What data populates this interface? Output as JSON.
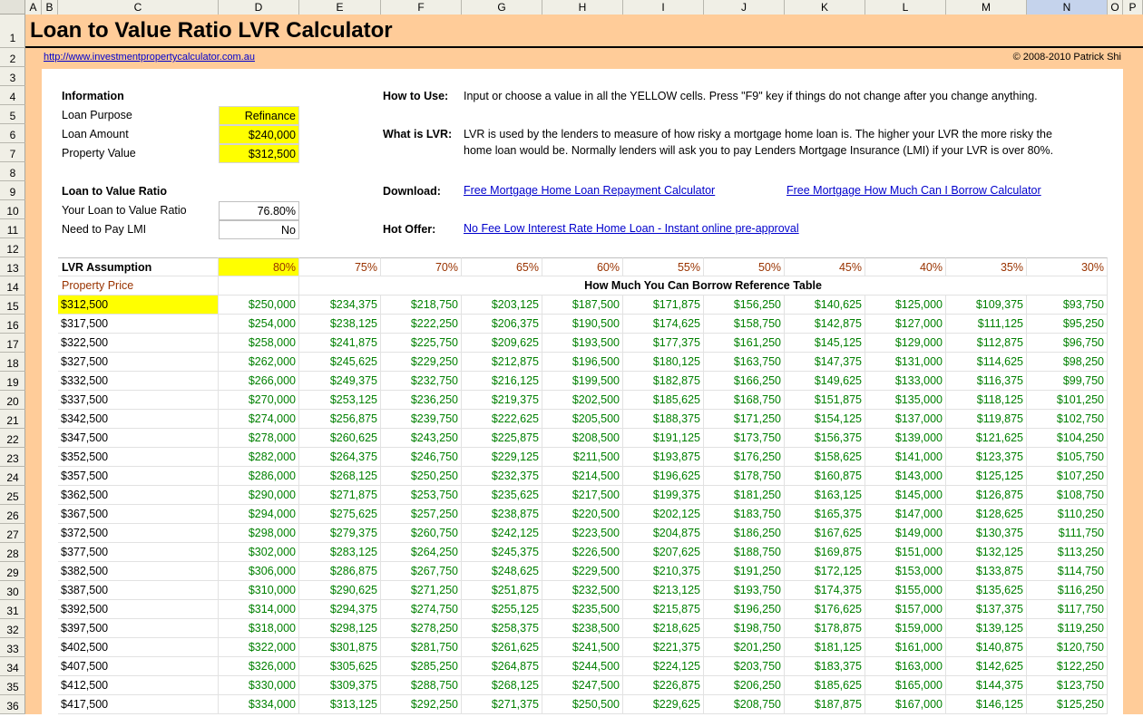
{
  "columns": [
    "A",
    "B",
    "C",
    "D",
    "E",
    "F",
    "G",
    "H",
    "I",
    "J",
    "K",
    "L",
    "M",
    "N",
    "O",
    "P"
  ],
  "selected_column": "N",
  "title": "Loan to Value Ratio LVR Calculator",
  "site_link": "http://www.investmentpropertycalculator.com.au",
  "copyright": "© 2008-2010 Patrick Shi",
  "information": {
    "heading": "Information",
    "loan_purpose_label": "Loan Purpose",
    "loan_purpose_value": "Refinance",
    "loan_amount_label": "Loan Amount",
    "loan_amount_value": "$240,000",
    "property_value_label": "Property Value",
    "property_value_value": "$312,500"
  },
  "ratio": {
    "heading": "Loan to Value Ratio",
    "your_lvr_label": "Your Loan to Value Ratio",
    "your_lvr_value": "76.80%",
    "lmi_label": "Need to Pay LMI",
    "lmi_value": "No"
  },
  "how_to_use": {
    "label": "How to Use:",
    "text": "Input or choose a value in all the YELLOW cells. Press \"F9\" key if things do not change after you change anything."
  },
  "what_is_lvr": {
    "label": "What is LVR:",
    "line1": "LVR is used by the lenders to measure of how risky a mortgage home loan is. The higher your LVR the more risky the",
    "line2": "home loan would be. Normally lenders will ask you to pay Lenders Mortgage Insurance (LMI) if your LVR is over 80%."
  },
  "download": {
    "label": "Download:",
    "link1": "Free Mortgage Home Loan Repayment Calculator",
    "link2": "Free Mortgage How Much Can I Borrow Calculator"
  },
  "hot_offer": {
    "label": "Hot Offer:",
    "link": "No Fee Low Interest Rate Home Loan - Instant online pre-approval"
  },
  "table": {
    "assumption_label": "LVR Assumption",
    "property_price_label": "Property Price",
    "reference_title": "How Much You Can Borrow Reference Table",
    "percents": [
      "80%",
      "75%",
      "70%",
      "65%",
      "60%",
      "55%",
      "50%",
      "45%",
      "40%",
      "35%",
      "30%"
    ],
    "rows": [
      {
        "price": "$312,500",
        "values": [
          "$250,000",
          "$234,375",
          "$218,750",
          "$203,125",
          "$187,500",
          "$171,875",
          "$156,250",
          "$140,625",
          "$125,000",
          "$109,375",
          "$93,750"
        ]
      },
      {
        "price": "$317,500",
        "values": [
          "$254,000",
          "$238,125",
          "$222,250",
          "$206,375",
          "$190,500",
          "$174,625",
          "$158,750",
          "$142,875",
          "$127,000",
          "$111,125",
          "$95,250"
        ]
      },
      {
        "price": "$322,500",
        "values": [
          "$258,000",
          "$241,875",
          "$225,750",
          "$209,625",
          "$193,500",
          "$177,375",
          "$161,250",
          "$145,125",
          "$129,000",
          "$112,875",
          "$96,750"
        ]
      },
      {
        "price": "$327,500",
        "values": [
          "$262,000",
          "$245,625",
          "$229,250",
          "$212,875",
          "$196,500",
          "$180,125",
          "$163,750",
          "$147,375",
          "$131,000",
          "$114,625",
          "$98,250"
        ]
      },
      {
        "price": "$332,500",
        "values": [
          "$266,000",
          "$249,375",
          "$232,750",
          "$216,125",
          "$199,500",
          "$182,875",
          "$166,250",
          "$149,625",
          "$133,000",
          "$116,375",
          "$99,750"
        ]
      },
      {
        "price": "$337,500",
        "values": [
          "$270,000",
          "$253,125",
          "$236,250",
          "$219,375",
          "$202,500",
          "$185,625",
          "$168,750",
          "$151,875",
          "$135,000",
          "$118,125",
          "$101,250"
        ]
      },
      {
        "price": "$342,500",
        "values": [
          "$274,000",
          "$256,875",
          "$239,750",
          "$222,625",
          "$205,500",
          "$188,375",
          "$171,250",
          "$154,125",
          "$137,000",
          "$119,875",
          "$102,750"
        ]
      },
      {
        "price": "$347,500",
        "values": [
          "$278,000",
          "$260,625",
          "$243,250",
          "$225,875",
          "$208,500",
          "$191,125",
          "$173,750",
          "$156,375",
          "$139,000",
          "$121,625",
          "$104,250"
        ]
      },
      {
        "price": "$352,500",
        "values": [
          "$282,000",
          "$264,375",
          "$246,750",
          "$229,125",
          "$211,500",
          "$193,875",
          "$176,250",
          "$158,625",
          "$141,000",
          "$123,375",
          "$105,750"
        ]
      },
      {
        "price": "$357,500",
        "values": [
          "$286,000",
          "$268,125",
          "$250,250",
          "$232,375",
          "$214,500",
          "$196,625",
          "$178,750",
          "$160,875",
          "$143,000",
          "$125,125",
          "$107,250"
        ]
      },
      {
        "price": "$362,500",
        "values": [
          "$290,000",
          "$271,875",
          "$253,750",
          "$235,625",
          "$217,500",
          "$199,375",
          "$181,250",
          "$163,125",
          "$145,000",
          "$126,875",
          "$108,750"
        ]
      },
      {
        "price": "$367,500",
        "values": [
          "$294,000",
          "$275,625",
          "$257,250",
          "$238,875",
          "$220,500",
          "$202,125",
          "$183,750",
          "$165,375",
          "$147,000",
          "$128,625",
          "$110,250"
        ]
      },
      {
        "price": "$372,500",
        "values": [
          "$298,000",
          "$279,375",
          "$260,750",
          "$242,125",
          "$223,500",
          "$204,875",
          "$186,250",
          "$167,625",
          "$149,000",
          "$130,375",
          "$111,750"
        ]
      },
      {
        "price": "$377,500",
        "values": [
          "$302,000",
          "$283,125",
          "$264,250",
          "$245,375",
          "$226,500",
          "$207,625",
          "$188,750",
          "$169,875",
          "$151,000",
          "$132,125",
          "$113,250"
        ]
      },
      {
        "price": "$382,500",
        "values": [
          "$306,000",
          "$286,875",
          "$267,750",
          "$248,625",
          "$229,500",
          "$210,375",
          "$191,250",
          "$172,125",
          "$153,000",
          "$133,875",
          "$114,750"
        ]
      },
      {
        "price": "$387,500",
        "values": [
          "$310,000",
          "$290,625",
          "$271,250",
          "$251,875",
          "$232,500",
          "$213,125",
          "$193,750",
          "$174,375",
          "$155,000",
          "$135,625",
          "$116,250"
        ]
      },
      {
        "price": "$392,500",
        "values": [
          "$314,000",
          "$294,375",
          "$274,750",
          "$255,125",
          "$235,500",
          "$215,875",
          "$196,250",
          "$176,625",
          "$157,000",
          "$137,375",
          "$117,750"
        ]
      },
      {
        "price": "$397,500",
        "values": [
          "$318,000",
          "$298,125",
          "$278,250",
          "$258,375",
          "$238,500",
          "$218,625",
          "$198,750",
          "$178,875",
          "$159,000",
          "$139,125",
          "$119,250"
        ]
      },
      {
        "price": "$402,500",
        "values": [
          "$322,000",
          "$301,875",
          "$281,750",
          "$261,625",
          "$241,500",
          "$221,375",
          "$201,250",
          "$181,125",
          "$161,000",
          "$140,875",
          "$120,750"
        ]
      },
      {
        "price": "$407,500",
        "values": [
          "$326,000",
          "$305,625",
          "$285,250",
          "$264,875",
          "$244,500",
          "$224,125",
          "$203,750",
          "$183,375",
          "$163,000",
          "$142,625",
          "$122,250"
        ]
      },
      {
        "price": "$412,500",
        "values": [
          "$330,000",
          "$309,375",
          "$288,750",
          "$268,125",
          "$247,500",
          "$226,875",
          "$206,250",
          "$185,625",
          "$165,000",
          "$144,375",
          "$123,750"
        ]
      },
      {
        "price": "$417,500",
        "values": [
          "$334,000",
          "$313,125",
          "$292,250",
          "$271,375",
          "$250,500",
          "$229,625",
          "$208,750",
          "$187,875",
          "$167,000",
          "$146,125",
          "$125,250"
        ]
      }
    ]
  },
  "row_numbers": [
    "1",
    "2",
    "3",
    "4",
    "5",
    "6",
    "7",
    "8",
    "9",
    "10",
    "11",
    "12",
    "13",
    "14",
    "15",
    "16",
    "17",
    "18",
    "19",
    "20",
    "21",
    "22",
    "23",
    "24",
    "25",
    "26",
    "27",
    "28",
    "29",
    "30",
    "31",
    "32",
    "33",
    "34",
    "35",
    "36"
  ]
}
